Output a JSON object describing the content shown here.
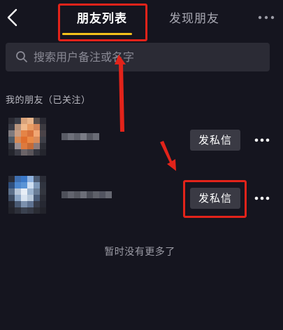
{
  "header": {
    "tabs": [
      {
        "label": "朋友列表",
        "active": true
      },
      {
        "label": "发现朋友",
        "active": false
      }
    ],
    "accent_color": "#f4c21b"
  },
  "search": {
    "placeholder": "搜索用户备注或名字",
    "value": ""
  },
  "friends_section": {
    "title": "我的朋友（已关注）",
    "items": [
      {
        "message_button_label": "发私信"
      },
      {
        "message_button_label": "发私信"
      }
    ]
  },
  "footer": {
    "empty_text": "暂时没有更多了"
  },
  "annotations": {
    "highlight_color": "#e2231a"
  },
  "icons": {
    "back": "chevron-left-icon",
    "more": "more-dots-icon",
    "search": "search-icon"
  }
}
